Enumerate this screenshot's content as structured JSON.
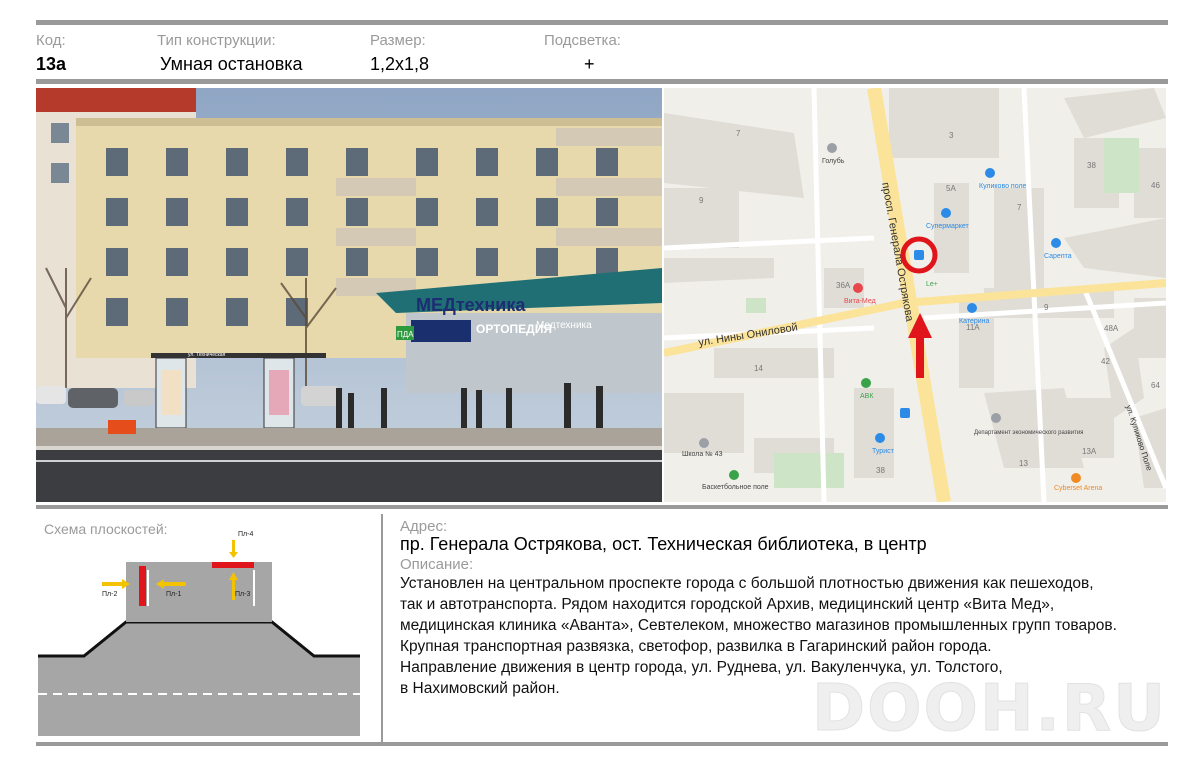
{
  "header": {
    "code_label": "Код:",
    "type_label": "Тип конструкции:",
    "size_label": "Размер:",
    "light_label": "Подсветка:",
    "code_value": "13а",
    "type_value": "Умная остановка",
    "size_value": "1,2х1,8",
    "light_value": "+"
  },
  "photo": {
    "shop_sign": "МЕДтехника",
    "shop_sign2": "ОРТОПЕДИЯ",
    "shop_sign3": "Медтехника",
    "pharmacy": "ПДА",
    "stop_sign": "ул. Техническая"
  },
  "map": {
    "avenue": "просп. Генерала Острякова",
    "street": "ул. Нины Ониловой",
    "street2": "ул. Куликово Поле",
    "pois": {
      "golub": "Голубь",
      "kulikovo": "Куликово поле",
      "supermarket": "Супермаркет",
      "sarepta": "Сарепта",
      "vitamed": "Вита-Мед",
      "le": "Le+",
      "katerina": "Катерина",
      "avk": "АВК",
      "turist": "Турист",
      "school": "Школа № 43",
      "basket": "Баскетбольное поле",
      "department": "Департамент экономического развития",
      "cyberset": "Cyberset Arena"
    },
    "houses": {
      "h7a": "7",
      "h3": "3",
      "h38a": "38",
      "h46": "46",
      "h9a": "9",
      "h5a": "5А",
      "h7b": "7",
      "h36a": "36А",
      "h9b": "9",
      "h11a": "11А",
      "h48a": "48А",
      "h42": "42",
      "h64": "64",
      "h14": "14",
      "h38b": "38",
      "h13": "13",
      "h13a": "13А"
    },
    "colors": {
      "road": "#fbe39a",
      "marker": "#e0141b",
      "poi_blue": "#2b8be6",
      "poi_red": "#e8464a",
      "poi_green": "#3aa34a",
      "poi_orange": "#f08a24"
    }
  },
  "schema": {
    "title": "Схема плоскостей:",
    "planes": [
      "Пл-1",
      "Пл-2",
      "Пл-3",
      "Пл-4"
    ]
  },
  "info": {
    "address_label": "Адрес:",
    "address": "пр. Генерала Острякова, ост. Техническая библиотека, в центр",
    "desc_label": "Описание:",
    "description_lines": [
      "Установлен на центральном проспекте города с большой плотностью движения как пешеходов,",
      "так и автотранспорта. Рядом находится городской Архив, медицинский центр «Вита Мед»,",
      "медицинская клиника «Аванта», Севтелеком, множество магазинов промышленных групп товаров.",
      "Крупная транспортная развязка, светофор, развилка в Гагаринский район города.",
      "Направление движения в центр города, ул. Руднева, ул. Вакуленчука, ул. Толстого,",
      "в Нахимовский район."
    ]
  },
  "watermark": "DOOH.RU"
}
